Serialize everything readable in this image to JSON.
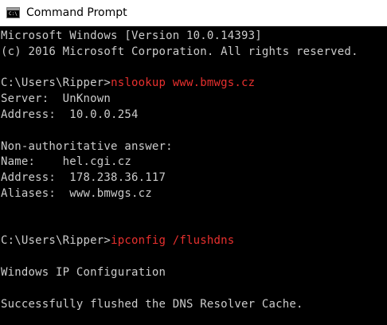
{
  "window": {
    "title": "Command Prompt",
    "icon": "command-prompt-icon"
  },
  "colors": {
    "background": "#000000",
    "text": "#cccccc",
    "command": "#e8302e"
  },
  "console": {
    "lines": [
      {
        "text": "Microsoft Windows [Version 10.0.14393]"
      },
      {
        "text": "(c) 2016 Microsoft Corporation. All rights reserved."
      },
      {
        "text": ""
      },
      {
        "prompt": "C:\\Users\\Ripper>",
        "command": "nslookup www.bmwgs.cz"
      },
      {
        "text": "Server:  UnKnown"
      },
      {
        "text": "Address:  10.0.0.254"
      },
      {
        "text": ""
      },
      {
        "text": "Non-authoritative answer:"
      },
      {
        "text": "Name:    hel.cgi.cz"
      },
      {
        "text": "Address:  178.238.36.117"
      },
      {
        "text": "Aliases:  www.bmwgs.cz"
      },
      {
        "text": ""
      },
      {
        "text": ""
      },
      {
        "prompt": "C:\\Users\\Ripper>",
        "command": "ipconfig /flushdns"
      },
      {
        "text": ""
      },
      {
        "text": "Windows IP Configuration"
      },
      {
        "text": ""
      },
      {
        "text": "Successfully flushed the DNS Resolver Cache."
      }
    ]
  }
}
